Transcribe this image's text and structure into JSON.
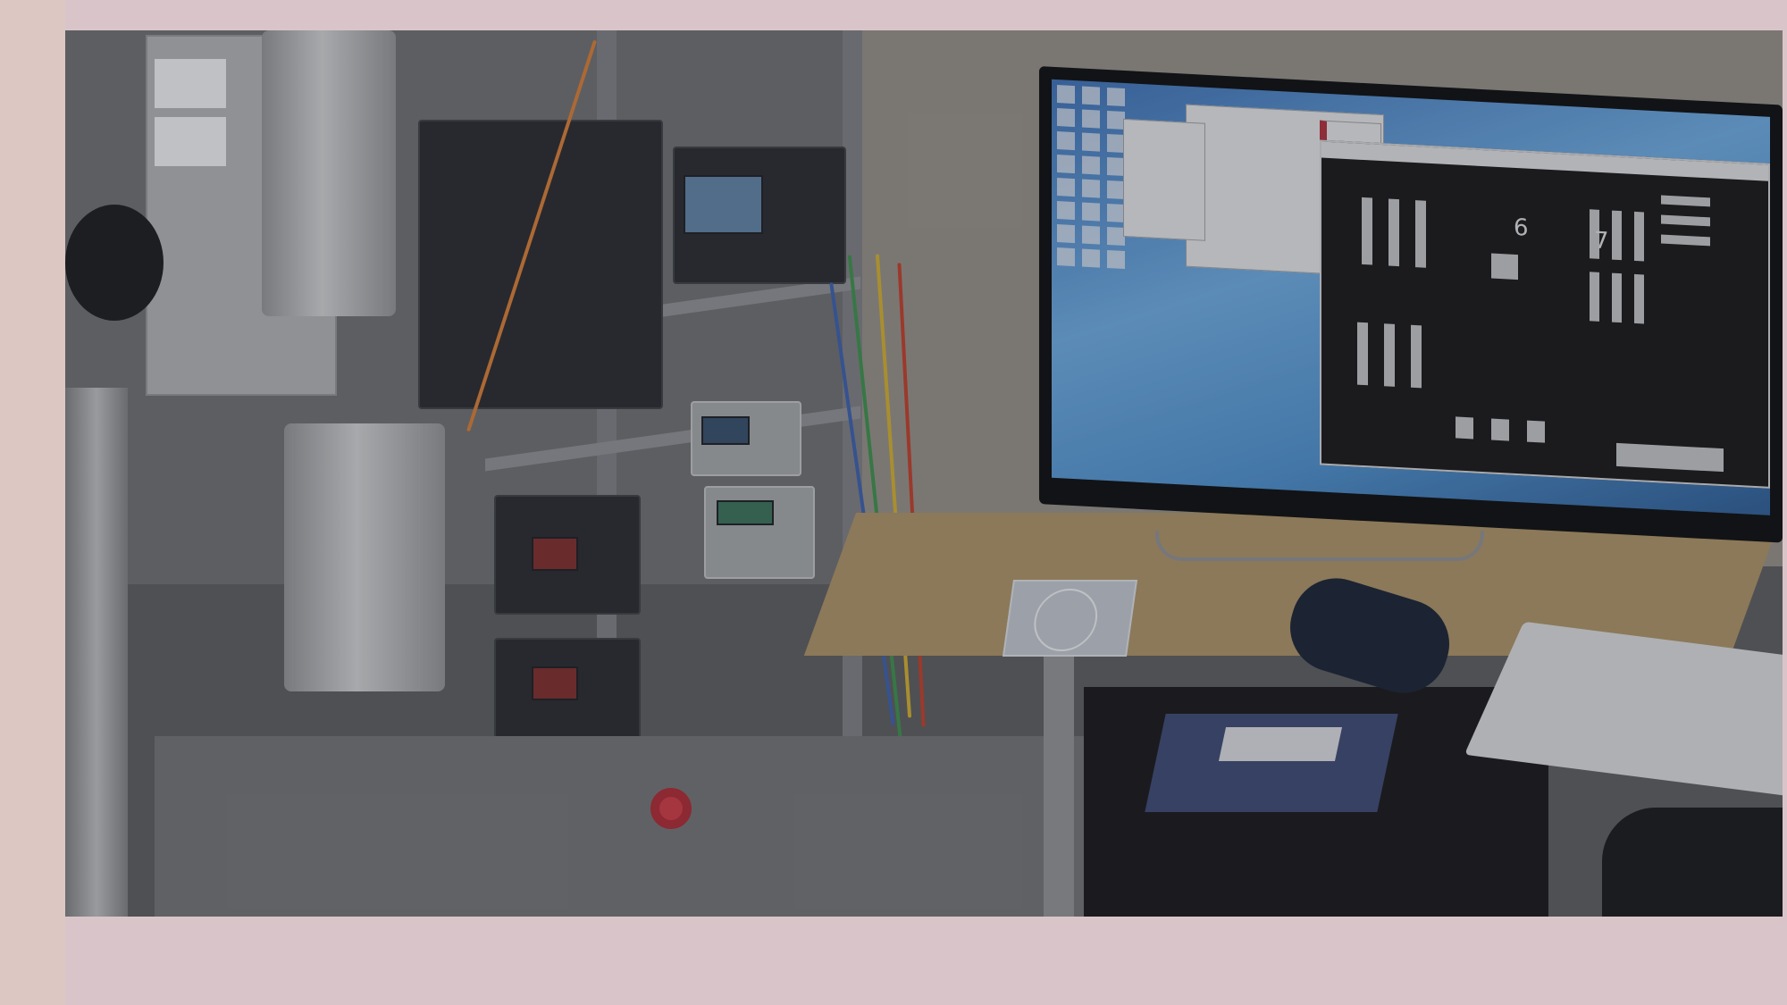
{
  "scene": {
    "caption": ""
  }
}
